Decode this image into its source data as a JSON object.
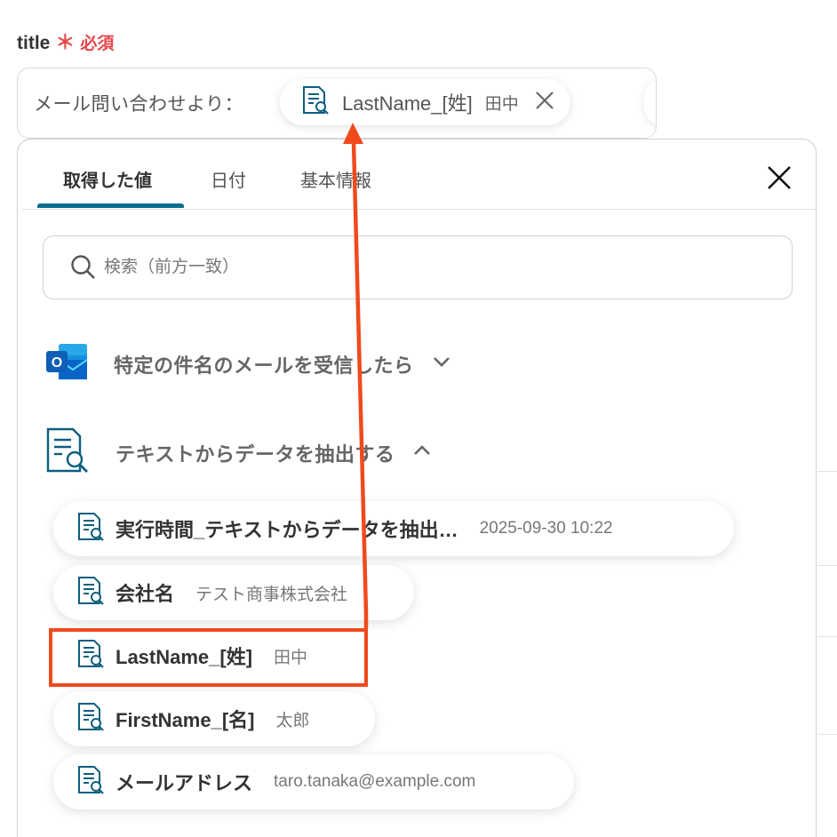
{
  "field": {
    "label": "title",
    "required_mark": "＊",
    "required_text": "必須",
    "prefix": "メール問い合わせより：",
    "chip": {
      "name": "LastName_[姓]",
      "value": "田中",
      "icon": "document-search-icon",
      "close_icon": "close-icon"
    }
  },
  "panel": {
    "tabs": [
      {
        "label": "取得した値",
        "active": true
      },
      {
        "label": "日付",
        "active": false
      },
      {
        "label": "基本情報",
        "active": false
      }
    ],
    "close_icon": "close-icon",
    "search": {
      "placeholder": "検索（前方一致）",
      "value": "",
      "icon": "search-icon"
    },
    "sections": [
      {
        "title": "特定の件名のメールを受信したら",
        "icon": "outlook-icon",
        "expanded": false
      },
      {
        "title": "テキストからデータを抽出する",
        "icon": "document-search-icon",
        "expanded": true,
        "items": [
          {
            "name": "実行時間_テキストからデータを抽出…",
            "value": "2025-09-30 10:22"
          },
          {
            "name": "会社名",
            "value": "テスト商事株式会社"
          },
          {
            "name": "LastName_[姓]",
            "value": "田中",
            "highlighted": true
          },
          {
            "name": "FirstName_[名]",
            "value": "太郎"
          },
          {
            "name": "メールアドレス",
            "value": "taro.tanaka@example.com"
          }
        ]
      }
    ]
  },
  "colors": {
    "accent": "#0b6d8f",
    "required": "#e5484d",
    "annotation": "#f04a1c",
    "outlook_blue": "#0a64c8"
  }
}
